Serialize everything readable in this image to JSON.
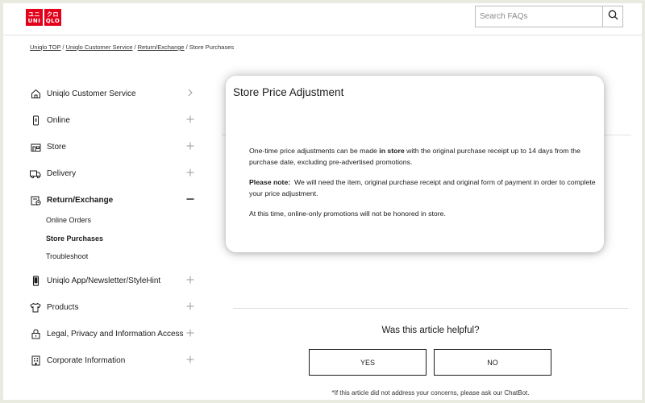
{
  "header": {
    "logo": {
      "top": [
        "ユニ",
        "UNI"
      ],
      "bottom": [
        "クロ",
        "QLO"
      ]
    },
    "search": {
      "placeholder": "Search FAQs"
    }
  },
  "breadcrumb": [
    {
      "label": "Uniqlo TOP",
      "link": true
    },
    {
      "label": "Uniqlo Customer Service",
      "link": true
    },
    {
      "label": "Return/Exchange",
      "link": true
    },
    {
      "label": "Store Purchases",
      "link": false
    }
  ],
  "sidebar": {
    "items": [
      {
        "label": "Uniqlo Customer Service",
        "icon": "home-icon",
        "toggle": "chevron-right"
      },
      {
        "label": "Online",
        "icon": "mobile-icon",
        "toggle": "plus"
      },
      {
        "label": "Store",
        "icon": "store-icon",
        "toggle": "plus"
      },
      {
        "label": "Delivery",
        "icon": "truck-icon",
        "toggle": "plus"
      },
      {
        "label": "Return/Exchange",
        "icon": "return-icon",
        "toggle": "minus"
      },
      {
        "label": "Uniqlo App/Newsletter/StyleHint",
        "icon": "phone-icon",
        "toggle": "plus"
      },
      {
        "label": "Products",
        "icon": "shirt-icon",
        "toggle": "plus"
      },
      {
        "label": "Legal, Privacy and Information Access",
        "icon": "lock-icon",
        "toggle": "plus"
      },
      {
        "label": "Corporate Information",
        "icon": "building-icon",
        "toggle": "plus"
      }
    ],
    "subitems": [
      {
        "label": "Online Orders"
      },
      {
        "label": "Store Purchases"
      },
      {
        "label": "Troubleshoot"
      }
    ]
  },
  "article": {
    "title": "Store Price Adjustment",
    "p1_before": "One-time price adjustments can be made ",
    "p1_bold": "in store",
    "p1_after": " with the original purchase receipt up to 14 days from the purchase date, excluding pre-advertised promotions.",
    "p2_bold": "Please note:",
    "p2_after": "  We will need the item, original purchase receipt and original form of payment in order to complete your price adjustment.",
    "p3": "At this time, online-only promotions will not be honored in store."
  },
  "feedback": {
    "question": "Was this article helpful?",
    "yes": "YES",
    "no": "NO",
    "note": "*If this article did not address your concerns, please ask our ChatBot."
  },
  "colors": {
    "brand": "#e3001b",
    "background": "#e9ebe0"
  }
}
